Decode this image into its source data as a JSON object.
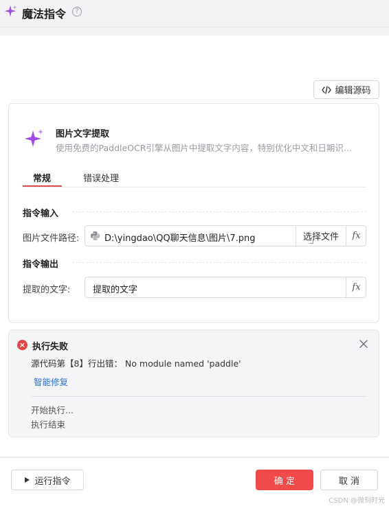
{
  "header": {
    "title": "魔法指令",
    "help_glyph": "?"
  },
  "toolbar": {
    "source_label": "编辑源码",
    "source_icon": "code-icon"
  },
  "card": {
    "name": "图片文字提取",
    "description": "使用免费的PaddleOCR引擎从图片中提取文字内容，特别优化中文和日期识...",
    "tabs": [
      {
        "label": "常规",
        "active": true
      },
      {
        "label": "错误处理",
        "active": false
      }
    ],
    "input_section": {
      "title": "指令输入",
      "image_path_label": "图片文件路径:",
      "image_path_value": "D:\\yingdao\\QQ聊天信息\\图片\\7.png",
      "choose_file_label": "选择文件",
      "fx_label": "fx"
    },
    "output_section": {
      "title": "指令输出",
      "text_label": "提取的文字:",
      "text_value": "提取的文字",
      "fx_label": "fx"
    }
  },
  "error": {
    "title": "执行失败",
    "message": "源代码第【8】行出错： No module named 'paddle'",
    "fix_label": "智能修复",
    "log": [
      "开始执行...",
      "执行结束"
    ]
  },
  "footer": {
    "run_label": "运行指令",
    "ok_label": "确 定",
    "cancel_label": "取 消",
    "watermark": "CSDN @微刻时光"
  },
  "colors": {
    "accent": "#f04a4a",
    "link": "#2a6fd6",
    "error": "#e04646",
    "spark": "#9b4de0"
  }
}
